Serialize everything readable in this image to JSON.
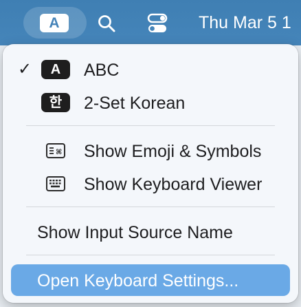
{
  "menubar": {
    "input_badge": "A",
    "search_icon": "search-icon",
    "control_icon": "control-center-icon",
    "clock": "Thu Mar 5  1"
  },
  "menu": {
    "input_sources": [
      {
        "badge": "A",
        "label": "ABC",
        "checked": true,
        "check_mark": "✓"
      },
      {
        "badge": "한",
        "label": "2-Set Korean",
        "checked": false
      }
    ],
    "actions": [
      {
        "icon": "emoji-symbols-icon",
        "label": "Show Emoji & Symbols"
      },
      {
        "icon": "keyboard-viewer-icon",
        "label": "Show Keyboard Viewer"
      }
    ],
    "show_input_source_name": "Show Input Source Name",
    "open_keyboard_settings": "Open Keyboard Settings..."
  },
  "colors": {
    "menubar": "#4585ba",
    "highlight": "#6aa9e6",
    "menu_background": "#f4f7fb"
  }
}
